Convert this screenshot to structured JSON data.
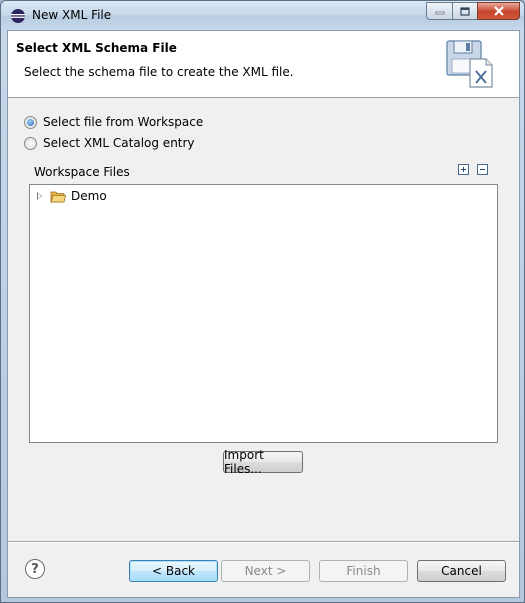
{
  "window": {
    "title": "New XML File"
  },
  "header": {
    "title": "Select XML Schema File",
    "description": "Select the schema file to create the XML file.",
    "icon": "xml-file-wizard-icon"
  },
  "options": [
    {
      "label": "Select file from Workspace",
      "checked": true
    },
    {
      "label": "Select XML Catalog entry",
      "checked": false
    }
  ],
  "workspace": {
    "label": "Workspace Files",
    "expand_icon": "expand-all-icon",
    "collapse_icon": "collapse-all-icon",
    "tree": [
      {
        "label": "Demo",
        "icon": "folder-icon",
        "expanded": false
      }
    ]
  },
  "import_button": "Import Files...",
  "footer": {
    "help_symbol": "?",
    "back": "< Back",
    "next": "Next >",
    "finish": "Finish",
    "cancel": "Cancel"
  },
  "colors": {
    "accent": "#3c7fb1",
    "close": "#c6452c"
  }
}
